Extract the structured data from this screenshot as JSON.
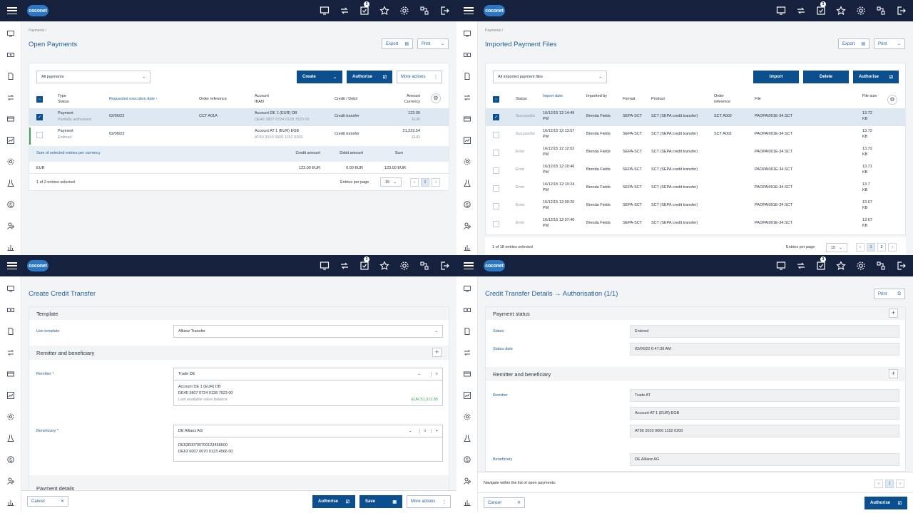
{
  "app": {
    "logo": "coconet",
    "tasks_badge": "3"
  },
  "q1": {
    "breadcrumb": "Payments  /",
    "title": "Open Payments",
    "export": "Export",
    "print": "Print",
    "filter": "All payments",
    "create": "Create",
    "authorise": "Authorise",
    "more_actions": "More actions",
    "columns": {
      "type": "Type",
      "status": "Status",
      "req_date": "Requested execution date ↑",
      "order_ref": "Order reference",
      "account": "Account",
      "iban": "IBAN",
      "credit_debit": "Credit / Debit",
      "amount": "Amount",
      "currency": "Currency"
    },
    "rows": [
      {
        "type": "Payment",
        "status": "Partially authorised",
        "date": "02/06/22",
        "order_ref": "CCT A01A",
        "account": "Account DE 1 (EUR) DB",
        "iban": "DE46 3807 0724 0128 7523 00",
        "cd": "Credit transfer",
        "amount": "123.00",
        "currency": "EUR"
      },
      {
        "type": "Payment",
        "status": "Entered",
        "date": "02/06/22",
        "order_ref": "",
        "account": "Account AT 1 (EUR) EGB",
        "iban": "AT50 2010 0600 1152 0200",
        "cd": "Credit transfer",
        "amount": "21,223.54",
        "currency": "EUR"
      }
    ],
    "sum": {
      "title": "Sum of selected entries per currency",
      "credit_label": "Credit amount",
      "debit_label": "Debit amount",
      "sum_label": "Sum",
      "currency": "EUR",
      "credit": "123.00 EUR",
      "debit": "0.00 EUR",
      "total": "123.00 EUR"
    },
    "footer": {
      "selected": "1 of 2 entries selected",
      "per_page_label": "Entries per page",
      "per_page": "15",
      "page": "1"
    }
  },
  "q2": {
    "breadcrumb": "Payments  /",
    "title": "Imported Payment Files",
    "export": "Export",
    "print": "Print",
    "filter": "All imported payment files",
    "import": "Import",
    "delete": "Delete",
    "authorise": "Authorise",
    "columns": {
      "status": "Status",
      "import_date": "Import date",
      "imported_by": "Imported by",
      "format": "Format",
      "product": "Product",
      "order_ref": "Order reference",
      "file": "File",
      "file_size": "File size"
    },
    "rows": [
      {
        "status": "Successful",
        "d1": "16/12/15 12:14:49",
        "d2": "PM",
        "by": "Brenda Fields",
        "format": "SEPA-SCT",
        "product": "SCT (SEPA credit transfer)",
        "ref": "SCT A002",
        "file": "PAOPAI001E-34.SCT",
        "s1": "13.72",
        "s2": "KB"
      },
      {
        "status": "Successful",
        "d1": "16/12/15 12:13:57",
        "d2": "PM",
        "by": "Brenda Fields",
        "format": "SEPA-SCT",
        "product": "SCT (SEPA credit transfer)",
        "ref": "SCT A001",
        "file": "PAOPAI001E-34.SCT",
        "s1": "13.72",
        "s2": "KB"
      },
      {
        "status": "Error",
        "d1": "16/12/15 12:12:02",
        "d2": "PM",
        "by": "Brenda Fields",
        "format": "SEPA-SCT",
        "product": "SCT (SEPA credit transfer)",
        "ref": "",
        "file": "PAOPAI001E-34.SCT",
        "s1": "13.72",
        "s2": "KB"
      },
      {
        "status": "Error",
        "d1": "16/12/15 12:10:46",
        "d2": "PM",
        "by": "Brenda Fields",
        "format": "SEPA-SCT",
        "product": "SCT (SEPA credit transfer)",
        "ref": "",
        "file": "PAOPAI001E-34.SCT",
        "s1": "13.71",
        "s2": "KB"
      },
      {
        "status": "Error",
        "d1": "16/12/15 12:10:24",
        "d2": "PM",
        "by": "Brenda Fields",
        "format": "SEPA-SCT",
        "product": "SCT (SEPA credit transfer)",
        "ref": "",
        "file": "PAOPAI001E-34.SCT",
        "s1": "13.7",
        "s2": "KB"
      },
      {
        "status": "Error",
        "d1": "16/12/15 12:09:26",
        "d2": "PM",
        "by": "Brenda Fields",
        "format": "SEPA-SCT",
        "product": "SCT (SEPA credit transfer)",
        "ref": "",
        "file": "PAOPAI001E-34.SCT",
        "s1": "13.67",
        "s2": "KB"
      },
      {
        "status": "Error",
        "d1": "16/12/15 12:07:46",
        "d2": "PM",
        "by": "Brenda Fields",
        "format": "SEPA-SCT",
        "product": "SCT (SEPA credit transfer)",
        "ref": "",
        "file": "PAOPAI001E-34.SCT",
        "s1": "13.67",
        "s2": "KB"
      }
    ],
    "footer": {
      "selected": "1 of 18 entries selected",
      "per_page_label": "Entries per page",
      "per_page": "15",
      "page1": "1",
      "page2": "2"
    }
  },
  "q3": {
    "title": "Create Credit Transfer",
    "template_section": "Template",
    "use_template_label": "Use template",
    "use_template_value": "Allianz Transfer",
    "rb_section": "Remitter and beneficiary",
    "remitter_label": "Remitter",
    "remitter_value": "Trade DE",
    "remitter_account": "Account DE 1 (EUR) DB",
    "remitter_iban": "DE46 3807 0724 0128 7523 00",
    "balance_label": "Last available value balance",
    "balance_value": "EUR 51,312.85",
    "beneficiary_label": "Beneficiary",
    "beneficiary_value": "DE Allianz AG",
    "beneficiary_iban1": "DE63600700700123456600",
    "beneficiary_iban2": "DE63 6007 0070 0123 4566 00",
    "payment_section": "Payment details",
    "cancel": "Cancel",
    "authorise": "Authorise",
    "save": "Save",
    "more_actions": "More actions"
  },
  "q4": {
    "title": "Credit Transfer Details → Authorisation (1/1)",
    "print": "Print",
    "status_section": "Payment status",
    "status_label": "Status",
    "status_value": "Entered",
    "status_date_label": "Status date",
    "status_date_value": "02/06/22 6:47:39 AM",
    "rb_section": "Remitter and beneficiary",
    "remitter_label": "Remitter",
    "remitter_value": "Trade AT",
    "remitter_account": "Account AT 1 (EUR) EGB",
    "remitter_iban": "AT50 2010 0600 1152 0200",
    "beneficiary_label": "Beneficiary",
    "beneficiary_value": "DE Allianz AG",
    "navigate": "Navigate within the list of open payments:",
    "page": "1",
    "cancel": "Cancel",
    "authorise": "Authorise"
  }
}
